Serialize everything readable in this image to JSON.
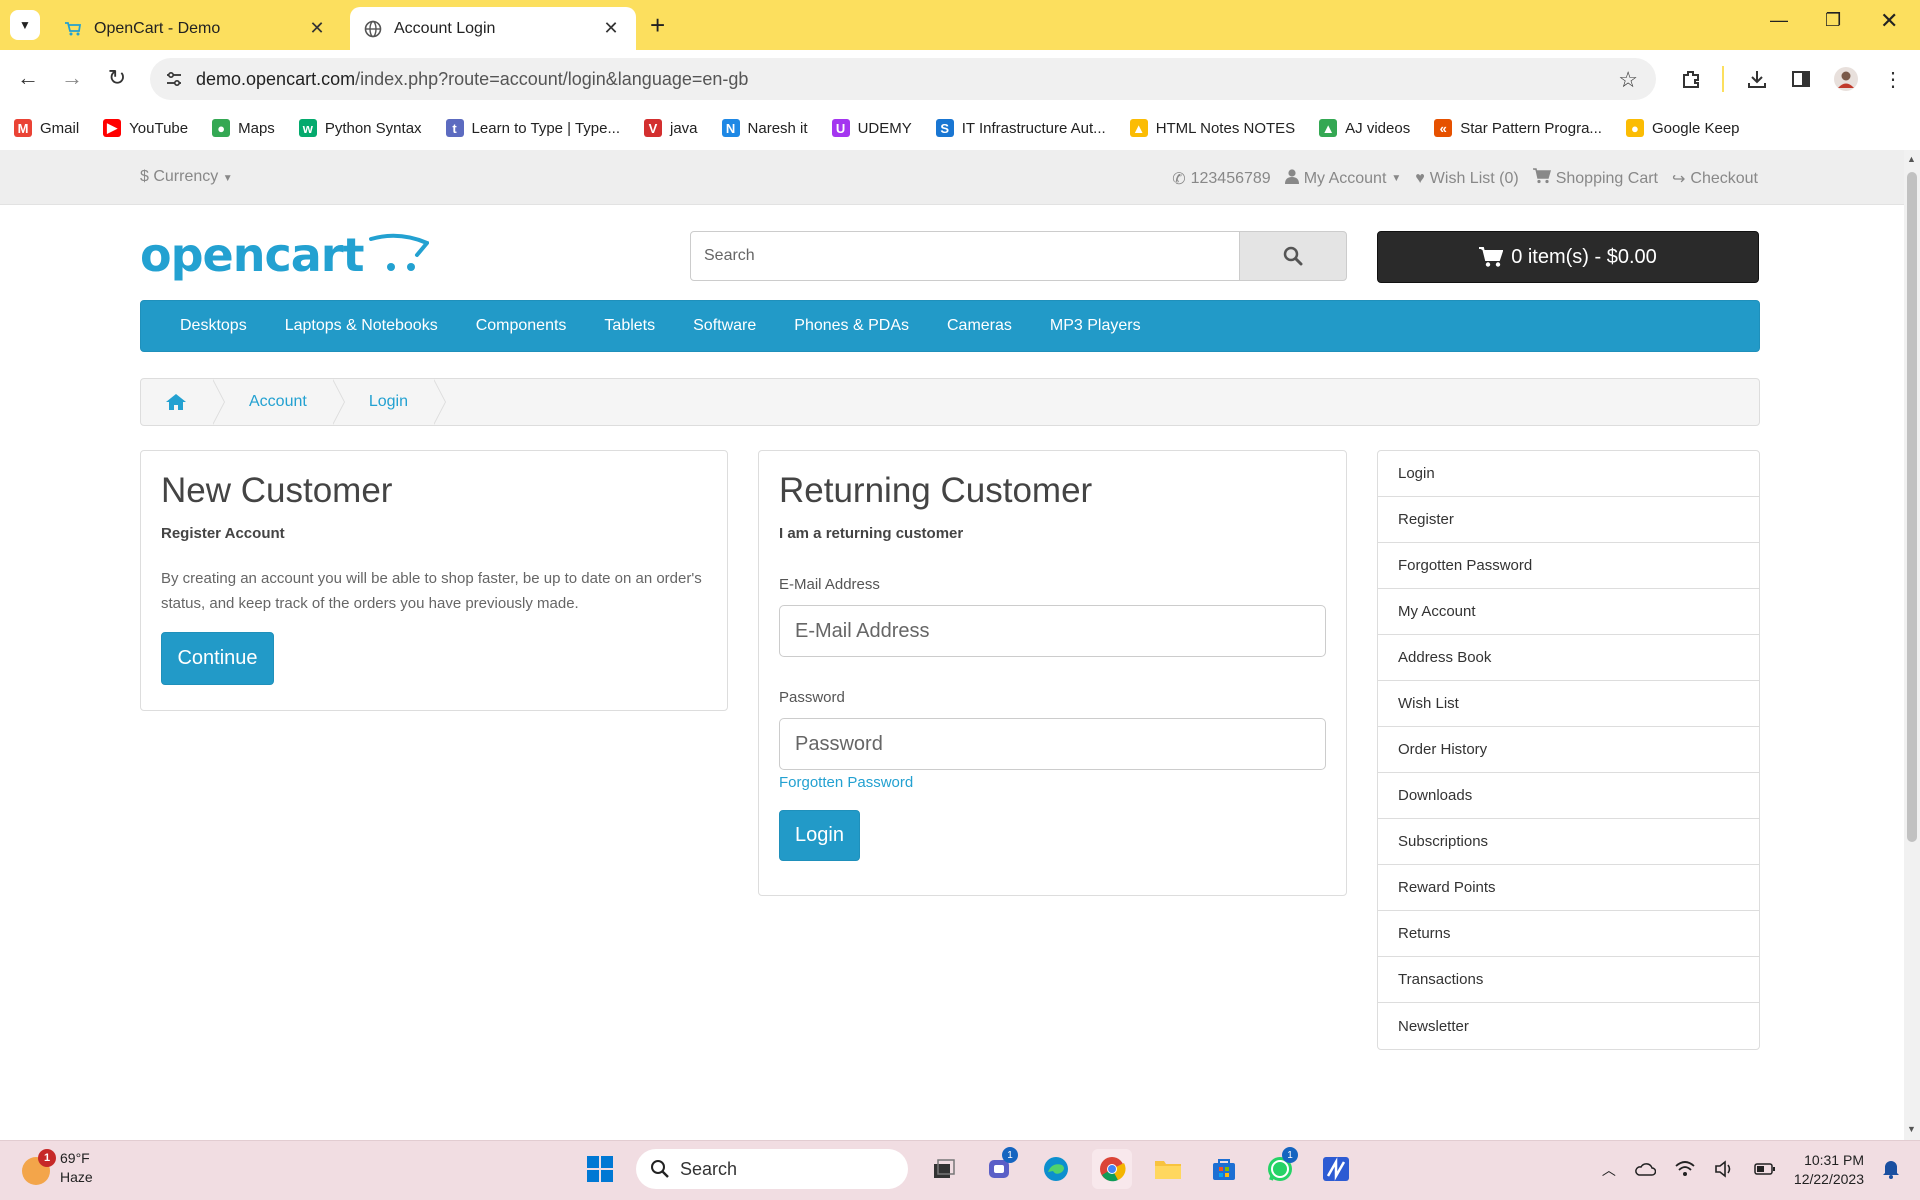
{
  "browser": {
    "tabs": [
      {
        "title": "OpenCart - Demo",
        "favicon": "cart-icon"
      },
      {
        "title": "Account Login",
        "favicon": "globe-icon"
      }
    ],
    "url_host": "demo.opencart.com",
    "url_path": "/index.php?route=account/login&language=en-gb",
    "bookmarks": [
      {
        "label": "Gmail",
        "icon": "gmail-icon",
        "color": "#ea4335",
        "glyph": "M"
      },
      {
        "label": "YouTube",
        "icon": "youtube-icon",
        "color": "#ff0000",
        "glyph": "▶"
      },
      {
        "label": "Maps",
        "icon": "maps-icon",
        "color": "#34a853",
        "glyph": "●"
      },
      {
        "label": "Python Syntax",
        "icon": "w3schools-icon",
        "color": "#04aa6d",
        "glyph": "w"
      },
      {
        "label": "Learn to Type | Type...",
        "icon": "typing-icon",
        "color": "#5c6bc0",
        "glyph": "t"
      },
      {
        "label": "java",
        "icon": "java-icon",
        "color": "#d32f2f",
        "glyph": "V"
      },
      {
        "label": "Naresh it",
        "icon": "naresh-icon",
        "color": "#1e88e5",
        "glyph": "N"
      },
      {
        "label": "UDEMY",
        "icon": "udemy-icon",
        "color": "#a435f0",
        "glyph": "U"
      },
      {
        "label": "IT Infrastructure Aut...",
        "icon": "it-icon",
        "color": "#1976d2",
        "glyph": "S"
      },
      {
        "label": "HTML Notes NOTES",
        "icon": "drive-icon",
        "color": "#fbbc04",
        "glyph": "▲"
      },
      {
        "label": "AJ videos",
        "icon": "drive-icon",
        "color": "#34a853",
        "glyph": "▲"
      },
      {
        "label": "Star Pattern Progra...",
        "icon": "star-pattern-icon",
        "color": "#e65100",
        "glyph": "«"
      },
      {
        "label": "Google Keep",
        "icon": "keep-icon",
        "color": "#fbbc04",
        "glyph": "●"
      }
    ]
  },
  "topbar": {
    "currency": "$ Currency",
    "phone": "123456789",
    "my_account": "My Account",
    "wishlist": "Wish List (0)",
    "cart": "Shopping Cart",
    "checkout": "Checkout"
  },
  "header": {
    "logo": "opencart",
    "search_placeholder": "Search",
    "cart_button": "0 item(s) - $0.00"
  },
  "menu": [
    "Desktops",
    "Laptops & Notebooks",
    "Components",
    "Tablets",
    "Software",
    "Phones & PDAs",
    "Cameras",
    "MP3 Players"
  ],
  "breadcrumb": [
    "Account",
    "Login"
  ],
  "new_customer": {
    "title": "New Customer",
    "subtitle": "Register Account",
    "text": "By creating an account you will be able to shop faster, be up to date on an order's status, and keep track of the orders you have previously made.",
    "button": "Continue"
  },
  "returning_customer": {
    "title": "Returning Customer",
    "subtitle": "I am a returning customer",
    "email_label": "E-Mail Address",
    "email_placeholder": "E-Mail Address",
    "password_label": "Password",
    "password_placeholder": "Password",
    "forgotten_link": "Forgotten Password",
    "button": "Login"
  },
  "sidebar": [
    "Login",
    "Register",
    "Forgotten Password",
    "My Account",
    "Address Book",
    "Wish List",
    "Order History",
    "Downloads",
    "Subscriptions",
    "Reward Points",
    "Returns",
    "Transactions",
    "Newsletter"
  ],
  "taskbar": {
    "weather_badge": "1",
    "temperature": "69°F",
    "condition": "Haze",
    "search": "Search",
    "teams_badge": "1",
    "whatsapp_badge": "1",
    "time": "10:31 PM",
    "date": "12/22/2023"
  },
  "colors": {
    "tabstrip": "#fcdf5e",
    "brand_blue": "#229ac8",
    "link_blue": "#23a1d1",
    "cart_dark": "#2a2a2a"
  }
}
